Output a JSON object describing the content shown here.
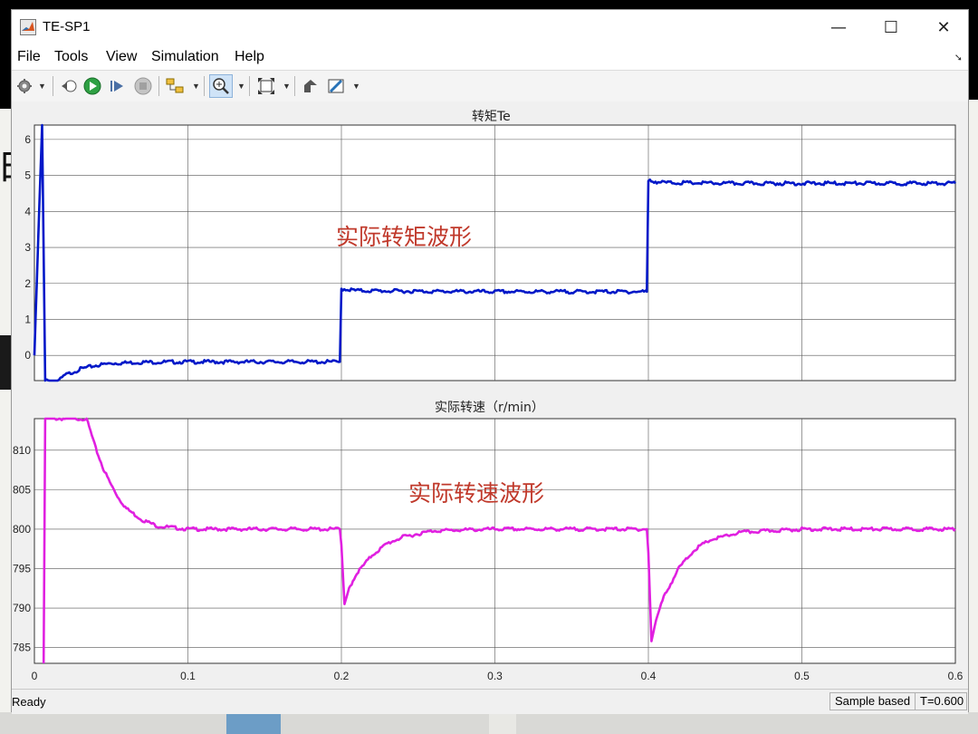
{
  "window": {
    "title": "TE-SP1",
    "controls": {
      "minimize": "—",
      "maximize": "☐",
      "close": "✕"
    }
  },
  "menu": {
    "items": [
      "File",
      "Tools",
      "View",
      "Simulation",
      "Help"
    ]
  },
  "toolbar": {
    "icons": [
      "gear-icon",
      "step-back-icon",
      "run-icon",
      "step-forward-icon",
      "stop-icon",
      "highlight-icon",
      "zoom-icon",
      "fit-icon",
      "layout-icon",
      "style-icon"
    ]
  },
  "background": {
    "glyph": "时"
  },
  "annotations": {
    "torque_wave": "实际转矩波形",
    "speed_wave": "实际转速波形"
  },
  "colors": {
    "torque_line": "#0018c8",
    "speed_line": "#e020e0",
    "annotation": "#c0392b"
  },
  "chart_data": [
    {
      "type": "line",
      "title": "转矩Te",
      "xlim": [
        0,
        0.6
      ],
      "ylim": [
        -0.7,
        6.4
      ],
      "yticks": [
        0,
        1,
        2,
        3,
        4,
        5,
        6
      ],
      "xticks": [],
      "grid": true,
      "series": [
        {
          "x": [
            0,
            0.005,
            0.007,
            0.008,
            0.016,
            0.02,
            0.03,
            0.04,
            0.05,
            0.07,
            0.1,
            0.15,
            0.199,
            0.2,
            0.201,
            0.21,
            0.25,
            0.3,
            0.35,
            0.399,
            0.4,
            0.401,
            0.41,
            0.45,
            0.5,
            0.55,
            0.6
          ],
          "y": [
            0,
            6.4,
            -0.7,
            -0.7,
            -0.7,
            -0.55,
            -0.38,
            -0.28,
            -0.22,
            -0.19,
            -0.18,
            -0.18,
            -0.18,
            1.85,
            1.85,
            1.8,
            1.78,
            1.77,
            1.77,
            1.77,
            4.85,
            4.85,
            4.8,
            4.78,
            4.78,
            4.78,
            4.78
          ]
        }
      ]
    },
    {
      "type": "line",
      "title": "实际转速（r/min）",
      "xlim": [
        0,
        0.6
      ],
      "ylim": [
        783,
        814
      ],
      "yticks": [
        785,
        790,
        795,
        800,
        805,
        810
      ],
      "xticks": [
        0,
        0.1,
        0.2,
        0.3,
        0.4,
        0.5,
        0.6
      ],
      "grid": true,
      "series": [
        {
          "x": [
            0.006,
            0.007,
            0.034,
            0.04,
            0.045,
            0.05,
            0.055,
            0.06,
            0.07,
            0.08,
            0.1,
            0.15,
            0.199,
            0.2,
            0.202,
            0.205,
            0.21,
            0.22,
            0.23,
            0.24,
            0.26,
            0.3,
            0.35,
            0.399,
            0.4,
            0.402,
            0.405,
            0.41,
            0.42,
            0.43,
            0.44,
            0.46,
            0.5,
            0.55,
            0.6
          ],
          "y": [
            783,
            814,
            814,
            810.2,
            807.6,
            805.6,
            803.9,
            802.6,
            801.2,
            800.4,
            800,
            800,
            800,
            798,
            790.5,
            792.5,
            794.4,
            796.7,
            798.2,
            799.0,
            799.8,
            800,
            800,
            800,
            797,
            785.8,
            788.5,
            791.4,
            795.1,
            797.4,
            798.6,
            799.6,
            800,
            800,
            800
          ]
        }
      ]
    }
  ],
  "status": {
    "text": "Ready",
    "sample_mode": "Sample based",
    "time": "T=0.600"
  }
}
